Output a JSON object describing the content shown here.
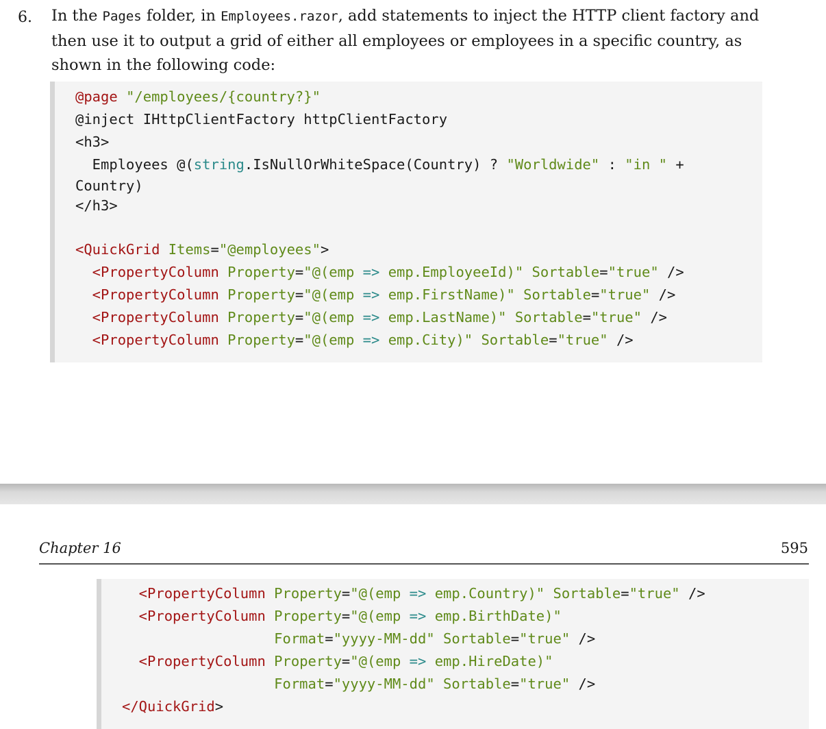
{
  "step": {
    "number": "6.",
    "text_parts": {
      "p1": "In the ",
      "folder": "Pages",
      "p2": " folder, in ",
      "file": "Employees.razor",
      "p3": ", add statements to inject the HTTP client factory and then use it to output a grid of either all employees or employees in a specific country, as shown in the following code:"
    }
  },
  "code_block_1": [
    [
      [
        "k",
        "@page "
      ],
      [
        "s",
        "\"/employees/{country?}\""
      ]
    ],
    [
      [
        "d",
        "@inject IHttpClientFactory httpClientFactory"
      ]
    ],
    [
      [
        "d",
        "<h3>"
      ]
    ],
    [
      [
        "d",
        "  Employees @("
      ],
      [
        "t",
        "string"
      ],
      [
        "d",
        ".IsNullOrWhiteSpace(Country) ? "
      ],
      [
        "s",
        "\"Worldwide\""
      ],
      [
        "d",
        " : "
      ],
      [
        "s",
        "\"in \""
      ],
      [
        "d",
        " +"
      ]
    ],
    [
      [
        "d",
        "Country)"
      ]
    ],
    [
      [
        "d",
        "</h3>"
      ]
    ],
    [
      [
        "d",
        ""
      ]
    ],
    [
      [
        "k",
        "<QuickGrid"
      ],
      [
        "s",
        " Items"
      ],
      [
        "d",
        "="
      ],
      [
        "s",
        "\"@employees\""
      ],
      [
        "d",
        ">"
      ]
    ],
    [
      [
        "k",
        "  <PropertyColumn"
      ],
      [
        "s",
        " Property"
      ],
      [
        "d",
        "="
      ],
      [
        "s",
        "\"@(emp "
      ],
      [
        "t",
        "=>"
      ],
      [
        "s",
        " emp.EmployeeId)\""
      ],
      [
        "s",
        " Sortable"
      ],
      [
        "d",
        "="
      ],
      [
        "s",
        "\"true\""
      ],
      [
        "d",
        " />"
      ]
    ],
    [
      [
        "k",
        "  <PropertyColumn"
      ],
      [
        "s",
        " Property"
      ],
      [
        "d",
        "="
      ],
      [
        "s",
        "\"@(emp "
      ],
      [
        "t",
        "=>"
      ],
      [
        "s",
        " emp.FirstName)\""
      ],
      [
        "s",
        " Sortable"
      ],
      [
        "d",
        "="
      ],
      [
        "s",
        "\"true\""
      ],
      [
        "d",
        " />"
      ]
    ],
    [
      [
        "k",
        "  <PropertyColumn"
      ],
      [
        "s",
        " Property"
      ],
      [
        "d",
        "="
      ],
      [
        "s",
        "\"@(emp "
      ],
      [
        "t",
        "=>"
      ],
      [
        "s",
        " emp.LastName)\""
      ],
      [
        "s",
        " Sortable"
      ],
      [
        "d",
        "="
      ],
      [
        "s",
        "\"true\""
      ],
      [
        "d",
        " />"
      ]
    ],
    [
      [
        "k",
        "  <PropertyColumn"
      ],
      [
        "s",
        " Property"
      ],
      [
        "d",
        "="
      ],
      [
        "s",
        "\"@(emp "
      ],
      [
        "t",
        "=>"
      ],
      [
        "s",
        " emp.City)\""
      ],
      [
        "s",
        " Sortable"
      ],
      [
        "d",
        "="
      ],
      [
        "s",
        "\"true\""
      ],
      [
        "d",
        " />"
      ]
    ]
  ],
  "page_header": {
    "chapter": "Chapter 16",
    "page_number": "595"
  },
  "code_block_2": [
    [
      [
        "k",
        "  <PropertyColumn"
      ],
      [
        "s",
        " Property"
      ],
      [
        "d",
        "="
      ],
      [
        "s",
        "\"@(emp "
      ],
      [
        "t",
        "=>"
      ],
      [
        "s",
        " emp.Country)\""
      ],
      [
        "s",
        " Sortable"
      ],
      [
        "d",
        "="
      ],
      [
        "s",
        "\"true\""
      ],
      [
        "d",
        " />"
      ]
    ],
    [
      [
        "k",
        "  <PropertyColumn"
      ],
      [
        "s",
        " Property"
      ],
      [
        "d",
        "="
      ],
      [
        "s",
        "\"@(emp "
      ],
      [
        "t",
        "=>"
      ],
      [
        "s",
        " emp.BirthDate)\""
      ]
    ],
    [
      [
        "s",
        "                  Format"
      ],
      [
        "d",
        "="
      ],
      [
        "s",
        "\"yyyy-MM-dd\""
      ],
      [
        "s",
        " Sortable"
      ],
      [
        "d",
        "="
      ],
      [
        "s",
        "\"true\""
      ],
      [
        "d",
        " />"
      ]
    ],
    [
      [
        "k",
        "  <PropertyColumn"
      ],
      [
        "s",
        " Property"
      ],
      [
        "d",
        "="
      ],
      [
        "s",
        "\"@(emp "
      ],
      [
        "t",
        "=>"
      ],
      [
        "s",
        " emp.HireDate)\""
      ]
    ],
    [
      [
        "s",
        "                  Format"
      ],
      [
        "d",
        "="
      ],
      [
        "s",
        "\"yyyy-MM-dd\""
      ],
      [
        "s",
        " Sortable"
      ],
      [
        "d",
        "="
      ],
      [
        "s",
        "\"true\""
      ],
      [
        "d",
        " />"
      ]
    ],
    [
      [
        "k",
        "</QuickGrid"
      ],
      [
        "d",
        ">"
      ]
    ]
  ]
}
